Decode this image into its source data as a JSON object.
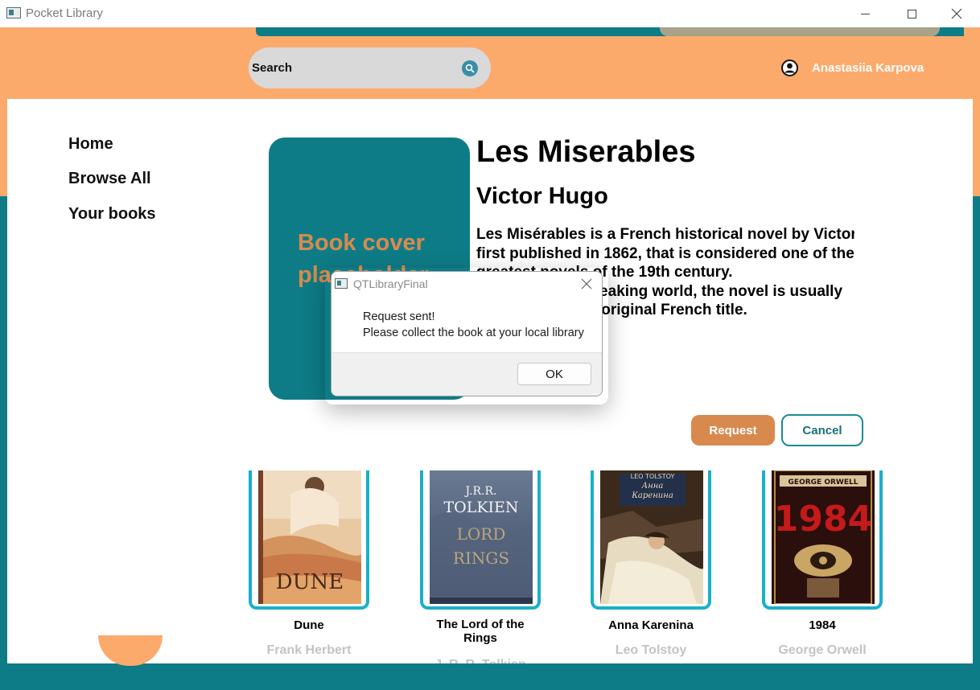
{
  "window": {
    "title": "Pocket Library"
  },
  "header": {
    "search_placeholder": "Search",
    "search_icon": "search-icon",
    "user_icon": "user-circle-icon",
    "user_name": "Anastasiia Karpova"
  },
  "nav": {
    "items": [
      {
        "label": "Home"
      },
      {
        "label": "Browse All"
      },
      {
        "label": "Your books"
      }
    ]
  },
  "book": {
    "cover_placeholder": "Book cover placeholder",
    "title": "Les Miserables",
    "author": "Victor Hugo",
    "description": [
      "Les Misérables is a French historical novel by Victor Hugo,",
      "first published in 1862, that is considered one of the",
      "greatest novels of the 19th century.",
      "In the English-speaking world, the novel is usually",
      "referred to by its original French title."
    ],
    "request_label": "Request",
    "cancel_label": "Cancel"
  },
  "recommended": [
    {
      "title": "Dune",
      "author": "Frank Herbert"
    },
    {
      "title": "The Lord of the Rings",
      "author": "J. R. R. Tolkien"
    },
    {
      "title": "Anna Karenina",
      "author": "Leo Tolstoy"
    },
    {
      "title": "1984",
      "author": "George Orwell"
    }
  ],
  "covers": {
    "dune_word": "DUNE",
    "lotr_author_initials": "J.R.R.",
    "lotr_author_surname": "TOLKIEN",
    "lotr_title_1": "LORD",
    "lotr_title_2": "RINGS",
    "anna_author": "LEO TOLSTOY",
    "anna_title_1": "Анна",
    "anna_title_2": "Каренина",
    "orwell_author": "GEORGE ORWELL",
    "orwell_title": "1984"
  },
  "dialog": {
    "title": "QTLibraryFinal",
    "message_line1": "Request sent!",
    "message_line2": "Please collect the book at your local library",
    "ok_label": "OK"
  },
  "colors": {
    "orange": "#fbaa6c",
    "teal": "#0e7c86",
    "accent_orange": "#d88a4e",
    "card_border": "#1ab0c8"
  }
}
